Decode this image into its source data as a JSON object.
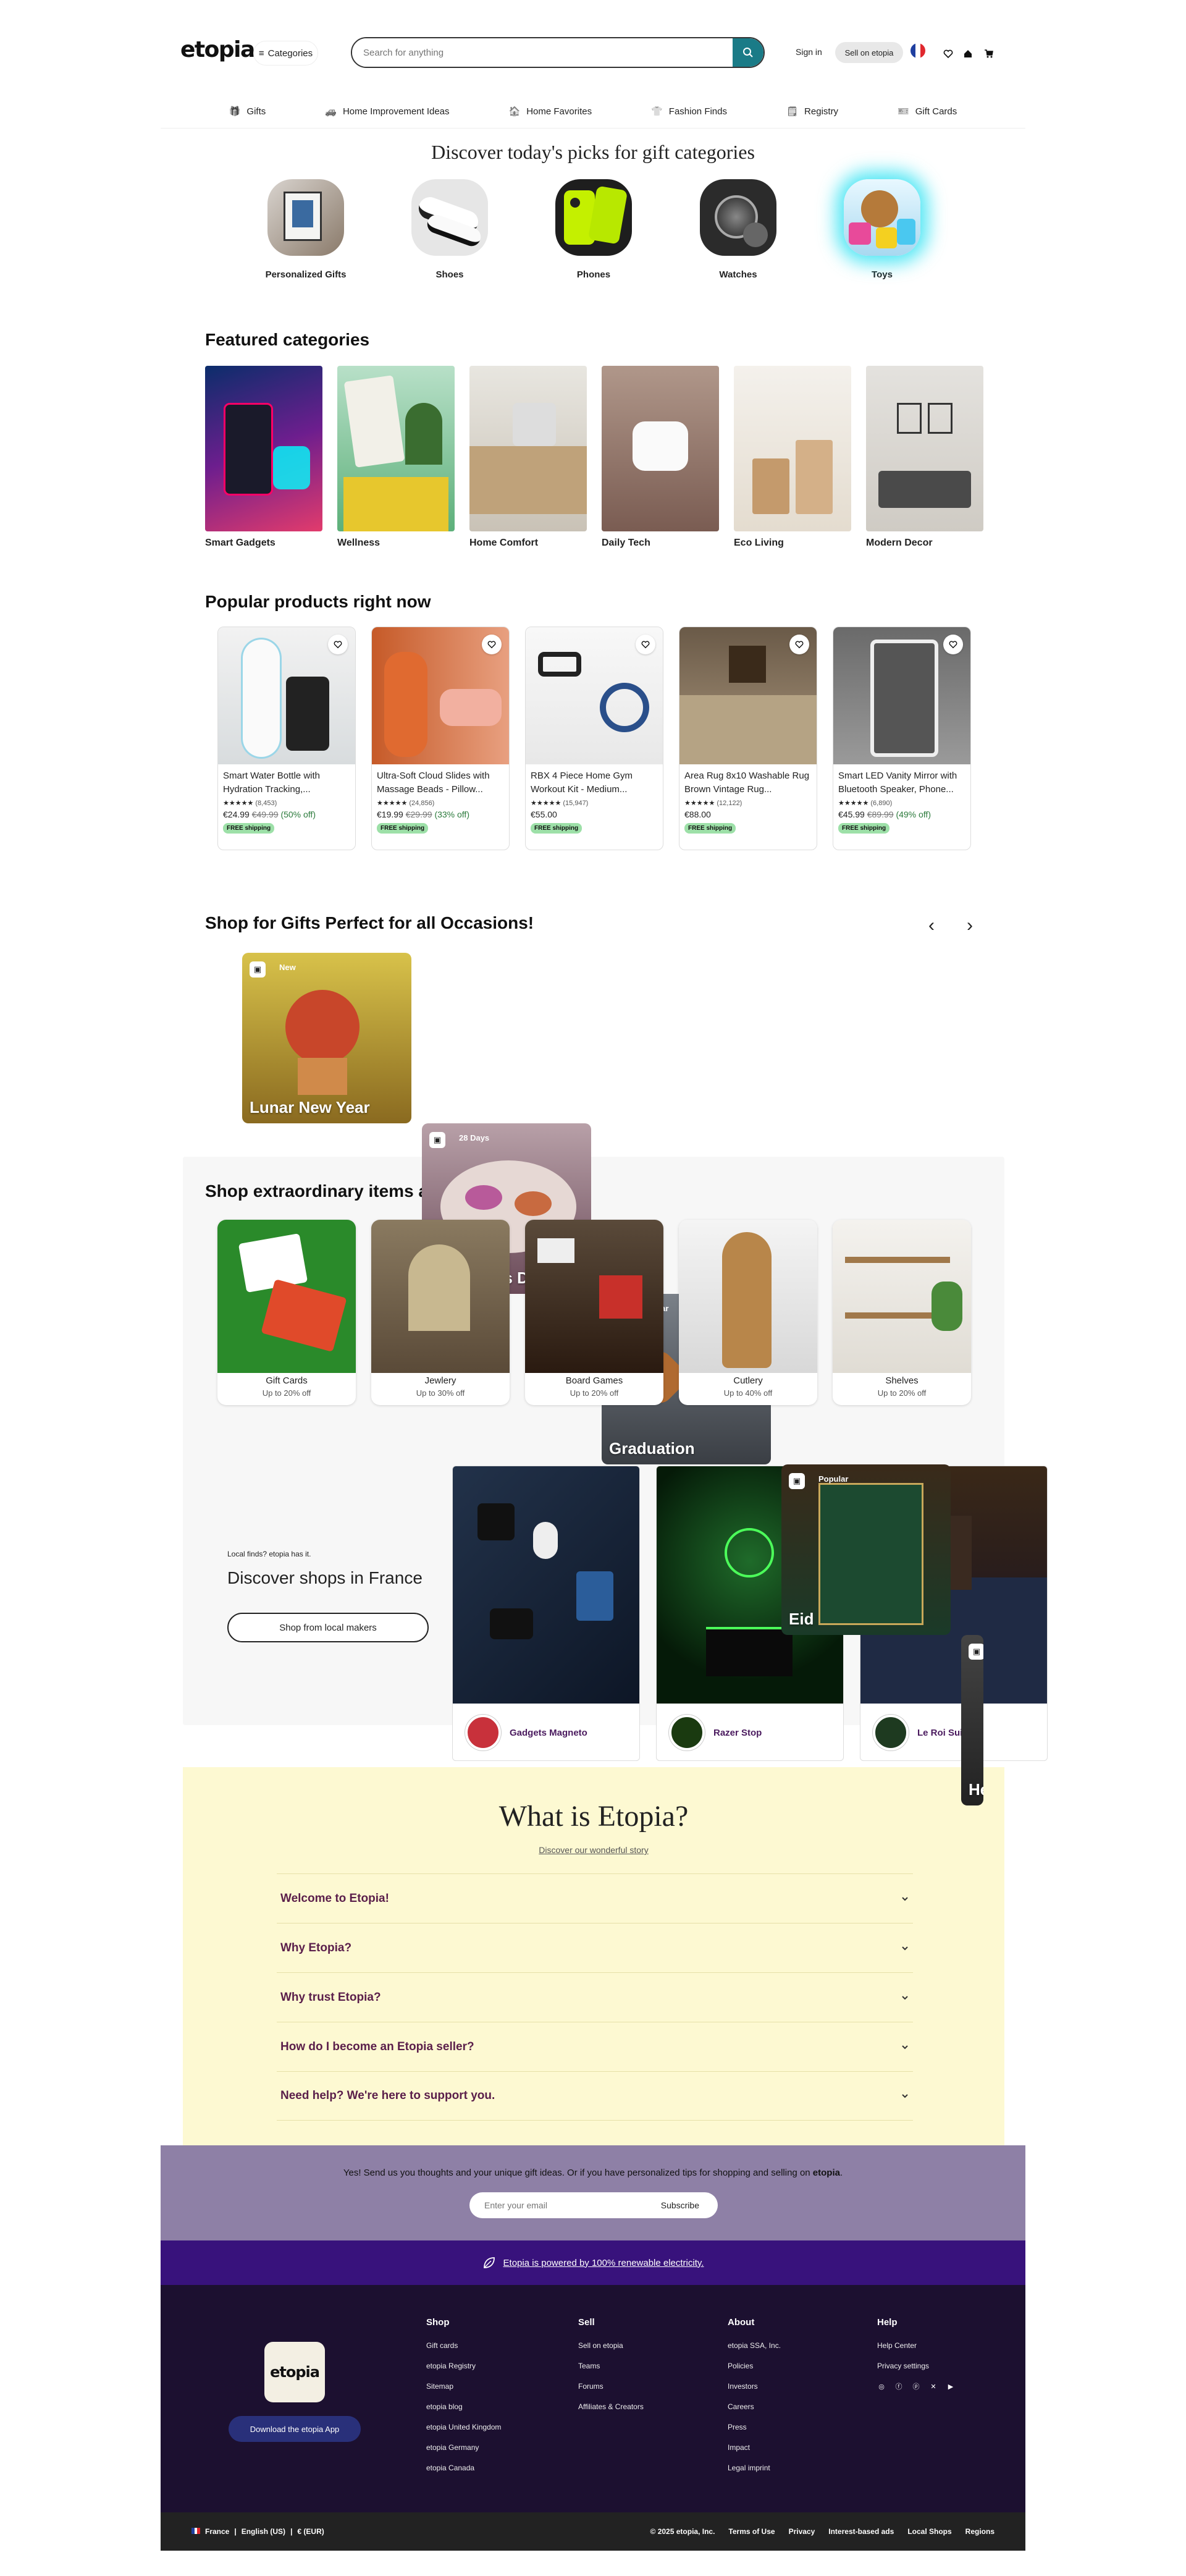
{
  "header": {
    "logo": "etopia",
    "categories": "Categories",
    "search_placeholder": "Search for anything",
    "signin": "Sign in",
    "sell": "Sell on etopia"
  },
  "nav": [
    {
      "label": "Gifts",
      "icon": "gift-icon"
    },
    {
      "label": "Home Improvement Ideas",
      "icon": "car-icon"
    },
    {
      "label": "Home Favorites",
      "icon": "home-icon"
    },
    {
      "label": "Fashion Finds",
      "icon": "shirt-icon"
    },
    {
      "label": "Registry",
      "icon": "registry-icon"
    },
    {
      "label": "Gift Cards",
      "icon": "gift-card-icon"
    }
  ],
  "gift_picks": {
    "title": "Discover today's picks for gift categories",
    "items": [
      "Personalized Gifts",
      "Shoes",
      "Phones",
      "Watches",
      "Toys"
    ]
  },
  "featured": {
    "title": "Featured categories",
    "items": [
      "Smart Gadgets",
      "Wellness",
      "Home Comfort",
      "Daily Tech",
      "Eco Living",
      "Modern Decor"
    ]
  },
  "popular": {
    "title": "Popular products right now",
    "items": [
      {
        "title": "Smart Water Bottle with Hydration Tracking,...",
        "stars": "★★★★★",
        "reviews": "(8,453)",
        "price": "€24.99",
        "old": "€49.99",
        "off": "(50% off)",
        "free": "FREE shipping"
      },
      {
        "title": "Ultra-Soft Cloud Slides with Massage Beads - Pillow...",
        "stars": "★★★★★",
        "reviews": "(24,856)",
        "price": "€19.99",
        "old": "€29.99",
        "off": "(33% off)",
        "free": "FREE shipping"
      },
      {
        "title": "RBX 4 Piece Home Gym Workout Kit - Medium...",
        "stars": "★★★★★",
        "reviews": "(15,947)",
        "price": "€55.00",
        "old": "",
        "off": "",
        "free": "FREE shipping"
      },
      {
        "title": "Area Rug 8x10 Washable Rug Brown Vintage Rug...",
        "stars": "★★★★★",
        "reviews": "(12,122)",
        "price": "€88.00",
        "old": "",
        "off": "",
        "free": "FREE shipping"
      },
      {
        "title": "Smart LED Vanity Mirror with Bluetooth Speaker, Phone...",
        "stars": "★★★★★",
        "reviews": "(6,890)",
        "price": "€45.99",
        "old": "€89.99",
        "off": "(49% off)",
        "free": "FREE shipping"
      }
    ]
  },
  "occasions": {
    "title": "Shop for Gifts Perfect for all Occasions!",
    "items": [
      {
        "tag": "New",
        "name": "Lunar New Year"
      },
      {
        "tag": "28 Days",
        "name": "Valentine's Day"
      },
      {
        "tag": "Popular",
        "name": "Graduation"
      },
      {
        "tag": "Popular",
        "name": "Eid"
      },
      {
        "tag": "",
        "name": "He"
      }
    ]
  },
  "special": {
    "title": "Shop extraordinary items at special prices",
    "items": [
      {
        "name": "Gift Cards",
        "off": "Up to 20% off"
      },
      {
        "name": "Jewlery",
        "off": "Up to 30% off"
      },
      {
        "name": "Board Games",
        "off": "Up to 20% off"
      },
      {
        "name": "Cutlery",
        "off": "Up to 40% off"
      },
      {
        "name": "Shelves",
        "off": "Up to 20% off"
      }
    ]
  },
  "local": {
    "small": "Local finds? etopia has it.",
    "title": "Discover shops in France",
    "button": "Shop from local makers",
    "shops": [
      "Gadgets Magneto",
      "Razer Stop",
      "Le Roi Suits"
    ]
  },
  "what": {
    "title": "What is Etopia?",
    "link": "Discover our wonderful story",
    "faqs": [
      "Welcome to Etopia!",
      "Why Etopia?",
      "Why trust Etopia?",
      "How do I become an Etopia seller?",
      "Need help? We're here to support you."
    ]
  },
  "newsletter": {
    "text_a": "Yes! Send us you thoughts and your unique gift ideas. Or if you have personalized tips for shopping and selling on ",
    "text_b": "etopia",
    "text_c": ".",
    "placeholder": "Enter your email",
    "button": "Subscribe"
  },
  "eco": "Etopia is powered by 100% renewable electricity.",
  "footer": {
    "logo": "etopia",
    "app": "Download the etopia App",
    "shop": {
      "title": "Shop",
      "links": [
        "Gift cards",
        "etopia Registry",
        "Sitemap",
        "etopia blog",
        "etopia United Kingdom",
        "etopia Germany",
        "etopia Canada"
      ]
    },
    "sell": {
      "title": "Sell",
      "links": [
        "Sell on etopia",
        "Teams",
        "Forums",
        "Affiliates & Creators"
      ]
    },
    "about": {
      "title": "About",
      "links": [
        "etopia SSA, Inc.",
        "Policies",
        "Investors",
        "Careers",
        "Press",
        "Impact",
        "Legal imprint"
      ]
    },
    "help": {
      "title": "Help",
      "links": [
        "Help Center",
        "Privacy settings"
      ]
    }
  },
  "bottom": {
    "region": "France",
    "lang": "English (US)",
    "currency": "€ (EUR)",
    "sep": "|",
    "copyright": "© 2025 etopia, Inc.",
    "links": [
      "Terms of Use",
      "Privacy",
      "Interest-based ads",
      "Local Shops",
      "Regions"
    ]
  },
  "colors": {
    "accent": "#1a7b87",
    "eco": "#38127c",
    "footer": "#1c1030",
    "news": "#8e80a6",
    "what": "#fdf9d2"
  }
}
